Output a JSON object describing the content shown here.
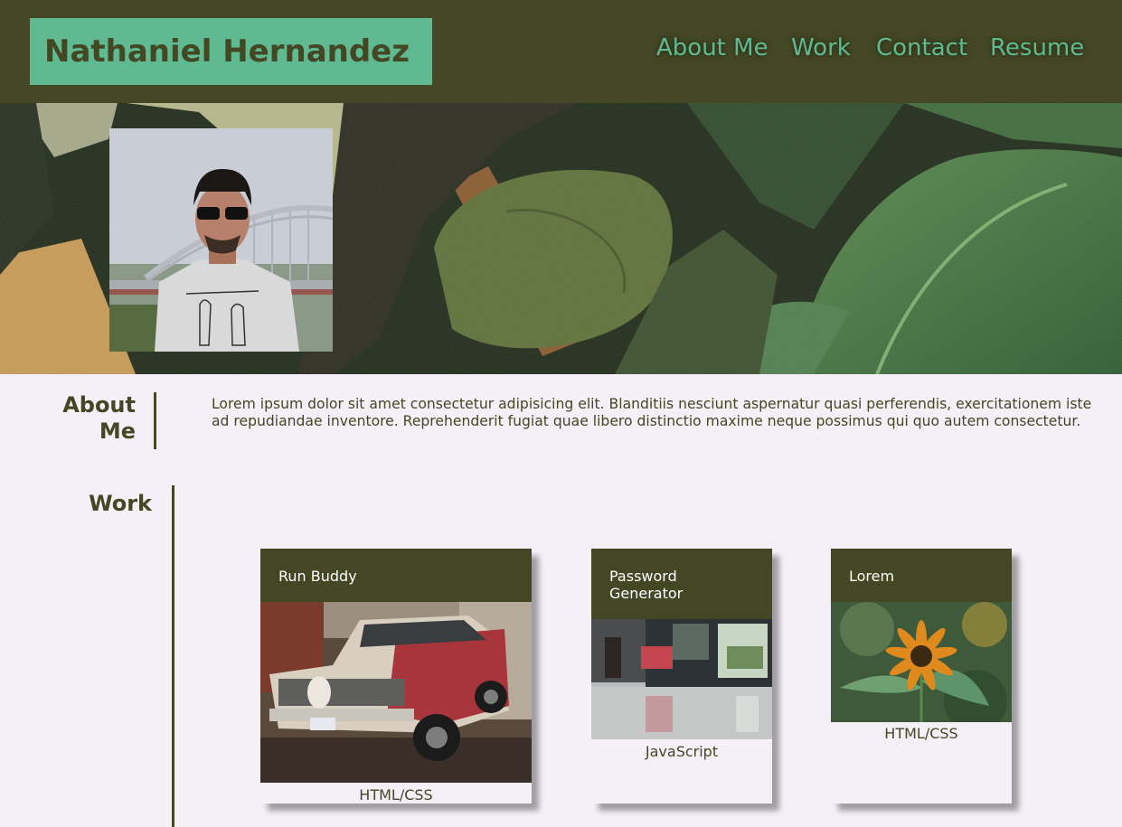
{
  "header": {
    "name": "Nathaniel Hernandez",
    "nav": [
      {
        "label": "About Me"
      },
      {
        "label": "Work"
      },
      {
        "label": "Contact"
      },
      {
        "label": "Resume"
      }
    ]
  },
  "about": {
    "title": "About Me",
    "text": "Lorem ipsum dolor sit amet consectetur adipisicing elit. Blanditiis nesciunt aspernatur quasi perferendis, exercitationem iste ad repudiandae inventore. Reprehenderit fugiat quae libero distinctio maxime neque possimus qui quo autem consectetur."
  },
  "work": {
    "title": "Work",
    "projects": [
      {
        "title": "Run Buddy",
        "tag": "HTML/CSS"
      },
      {
        "title": "Password Generator",
        "tag": "JavaScript"
      },
      {
        "title": "Lorem",
        "tag": "HTML/CSS"
      }
    ]
  },
  "colors": {
    "header_bg": "#434723",
    "accent": "#5fba91",
    "page_bg": "#f5f0f7"
  }
}
